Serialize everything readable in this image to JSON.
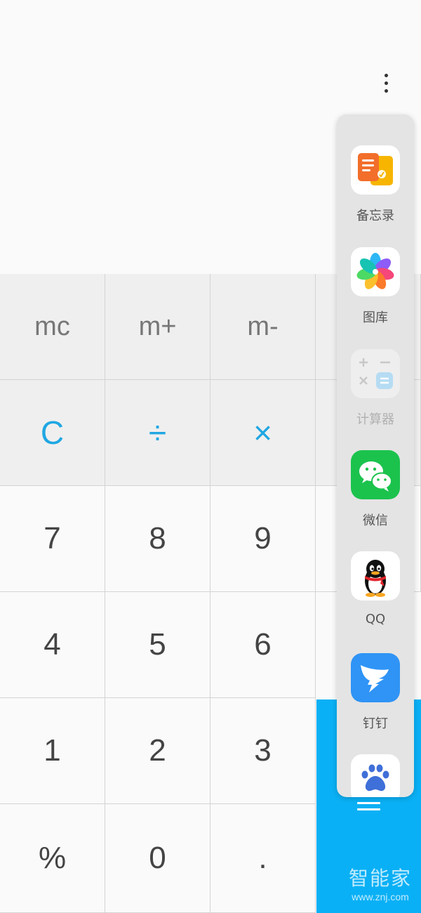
{
  "display": {
    "more_icon": "more-vertical-icon"
  },
  "keys": {
    "mc": "mc",
    "mplus": "m+",
    "mminus": "m-",
    "clear": "C",
    "divide": "÷",
    "multiply": "×",
    "seven": "7",
    "eight": "8",
    "nine": "9",
    "four": "4",
    "five": "5",
    "six": "6",
    "one": "1",
    "two": "2",
    "three": "3",
    "percent": "%",
    "zero": "0",
    "dot": "."
  },
  "equals_icon": "equals-icon",
  "side_panel": {
    "apps": [
      {
        "label": "备忘录",
        "icon": "notes-icon"
      },
      {
        "label": "图库",
        "icon": "gallery-icon"
      },
      {
        "label": "计算器",
        "icon": "calculator-icon"
      },
      {
        "label": "微信",
        "icon": "wechat-icon"
      },
      {
        "label": "QQ",
        "icon": "qq-icon"
      },
      {
        "label": "钉钉",
        "icon": "dingtalk-icon"
      },
      {
        "label": "",
        "icon": "baidu-icon"
      }
    ]
  },
  "watermark": {
    "main": "智能家",
    "url": "www.znj.com"
  },
  "colors": {
    "accent": "#1fa7e2",
    "equals_bg": "#0ab0f5",
    "key_gray": "#efefef",
    "key_white": "#fafafa"
  }
}
